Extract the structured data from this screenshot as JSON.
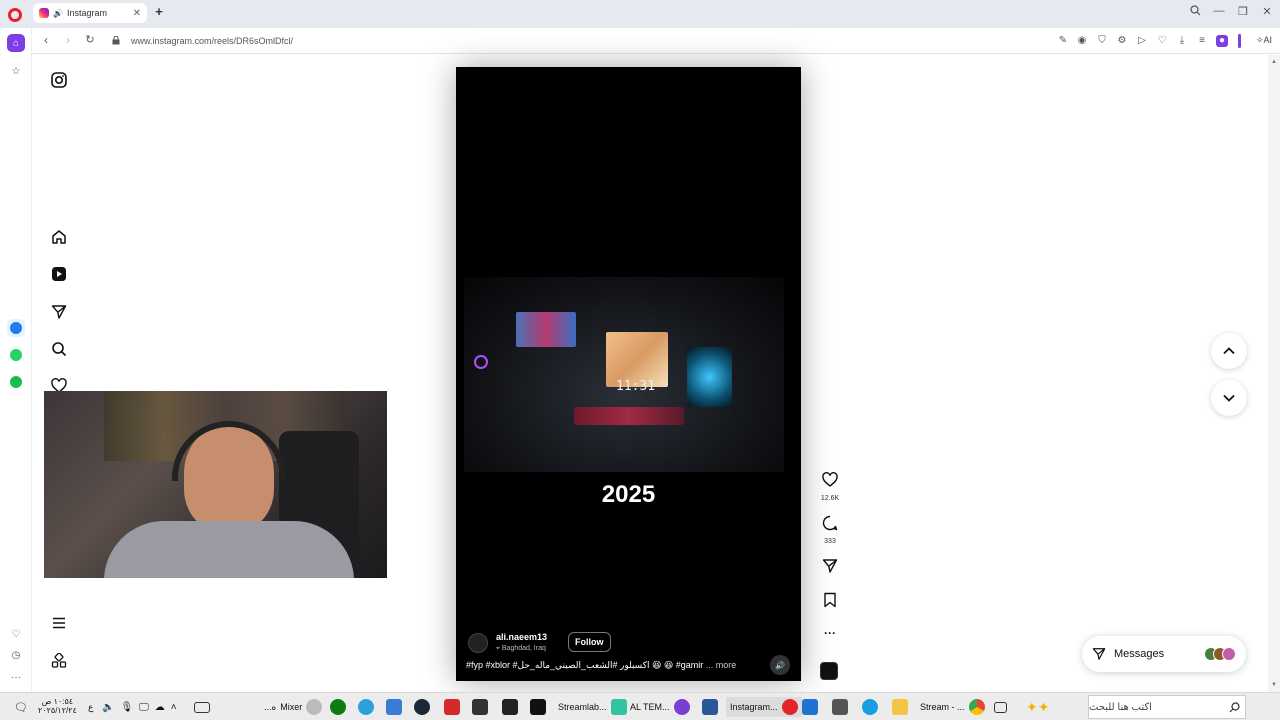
{
  "browser": {
    "tab_title": "Instagram",
    "url": "www.instagram.com/reels/DR6sOmlDfcl/",
    "ai_label": "AI"
  },
  "reel": {
    "overlay_text": "2025",
    "username": "ali.naeem13",
    "location": "Baghdad, Iraq",
    "follow_label": "Follow",
    "caption": "#fyp #xblor #اكسبلور #الشعب_الصيني_ماله_حل 😆 😆 #gamir",
    "caption_more": "... more",
    "clock_text": "11:31"
  },
  "actions": {
    "likes": "12.6K",
    "comments": "333"
  },
  "messages": {
    "label": "Messages"
  },
  "taskbar": {
    "time": "١٠:٥٤ ص",
    "date": "٢٠٢٥/١٢/٢٤",
    "lang": "ع",
    "mixer_label": "Mixer",
    "mixer_prefix": "...ه",
    "streamlab_label": "Streamlab...",
    "altem_label": "AL TEM...",
    "instagram_label": "Instagram...",
    "stream_label": "Stream - ...",
    "search_placeholder": "اكتب هنا للبحث"
  }
}
